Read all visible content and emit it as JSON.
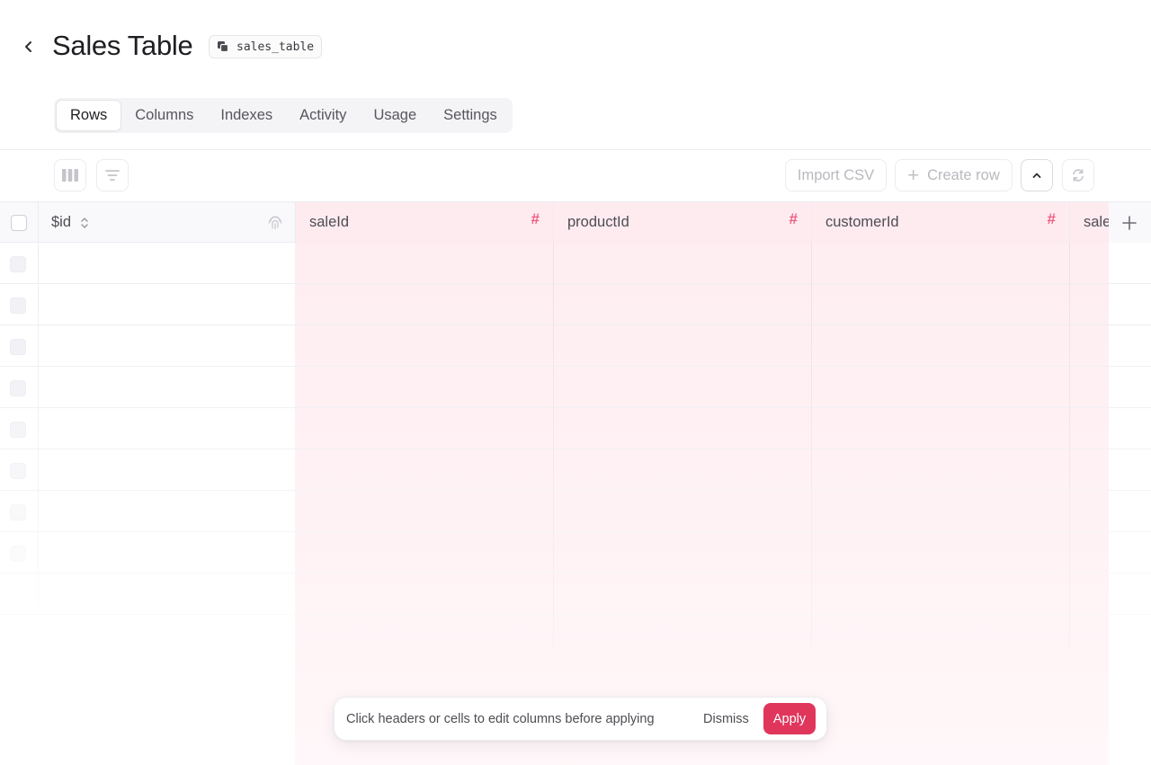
{
  "header": {
    "title": "Sales Table",
    "table_id": "sales_table"
  },
  "tabs": [
    {
      "label": "Rows",
      "active": true
    },
    {
      "label": "Columns",
      "active": false
    },
    {
      "label": "Indexes",
      "active": false
    },
    {
      "label": "Activity",
      "active": false
    },
    {
      "label": "Usage",
      "active": false
    },
    {
      "label": "Settings",
      "active": false
    }
  ],
  "toolbar": {
    "import_label": "Import CSV",
    "create_label": "Create row"
  },
  "table": {
    "columns": [
      {
        "name": "$id",
        "type_icon": "fingerprint-icon"
      },
      {
        "name": "saleId",
        "type_icon": "hash-icon",
        "type_symbol": "#"
      },
      {
        "name": "productId",
        "type_icon": "hash-icon",
        "type_symbol": "#"
      },
      {
        "name": "customerId",
        "type_icon": "hash-icon",
        "type_symbol": "#"
      },
      {
        "name": "sale",
        "type_icon": "hash-icon"
      }
    ]
  },
  "bottom_bar": {
    "message": "Click headers or cells to edit columns before applying",
    "dismiss_label": "Dismiss",
    "apply_label": "Apply"
  },
  "colors": {
    "accent": "#e0365c",
    "type_icon": "#ef5d7f",
    "suggested_column_bg": "#feecf0"
  }
}
